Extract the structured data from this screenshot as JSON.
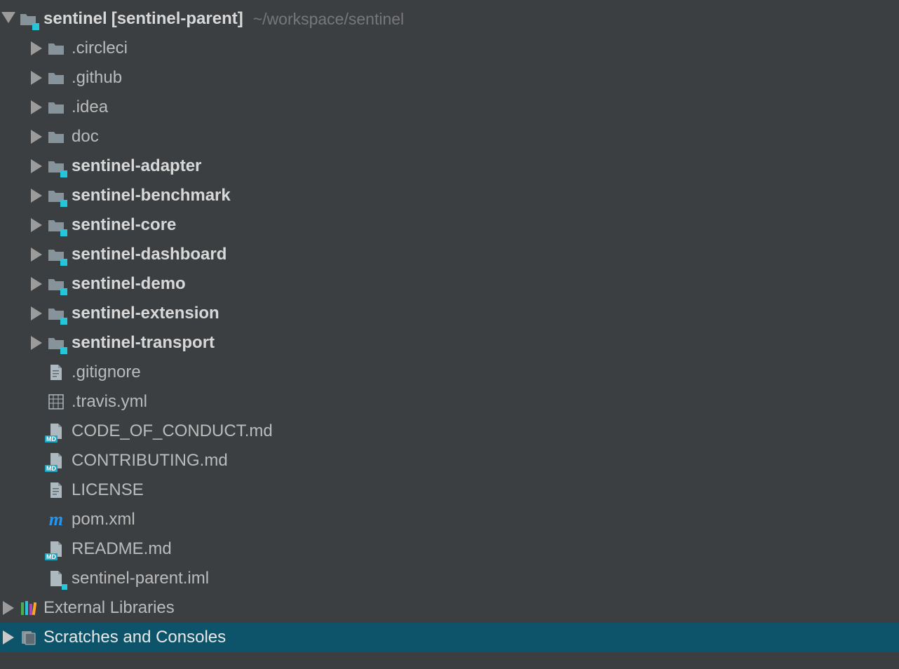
{
  "root": {
    "name": "sentinel",
    "module": "[sentinel-parent]",
    "path": "~/workspace/sentinel"
  },
  "children": [
    {
      "name": ".circleci",
      "type": "folder",
      "bold": false
    },
    {
      "name": ".github",
      "type": "folder",
      "bold": false
    },
    {
      "name": ".idea",
      "type": "folder",
      "bold": false
    },
    {
      "name": "doc",
      "type": "folder",
      "bold": false
    },
    {
      "name": "sentinel-adapter",
      "type": "module",
      "bold": true
    },
    {
      "name": "sentinel-benchmark",
      "type": "module",
      "bold": true
    },
    {
      "name": "sentinel-core",
      "type": "module",
      "bold": true
    },
    {
      "name": "sentinel-dashboard",
      "type": "module",
      "bold": true
    },
    {
      "name": "sentinel-demo",
      "type": "module",
      "bold": true
    },
    {
      "name": "sentinel-extension",
      "type": "module",
      "bold": true
    },
    {
      "name": "sentinel-transport",
      "type": "module",
      "bold": true
    },
    {
      "name": ".gitignore",
      "type": "file"
    },
    {
      "name": ".travis.yml",
      "type": "yml"
    },
    {
      "name": "CODE_OF_CONDUCT.md",
      "type": "md"
    },
    {
      "name": "CONTRIBUTING.md",
      "type": "md"
    },
    {
      "name": "LICENSE",
      "type": "file"
    },
    {
      "name": "pom.xml",
      "type": "maven"
    },
    {
      "name": "README.md",
      "type": "md"
    },
    {
      "name": "sentinel-parent.iml",
      "type": "iml"
    }
  ],
  "externalLibraries": "External Libraries",
  "scratches": "Scratches and Consoles"
}
